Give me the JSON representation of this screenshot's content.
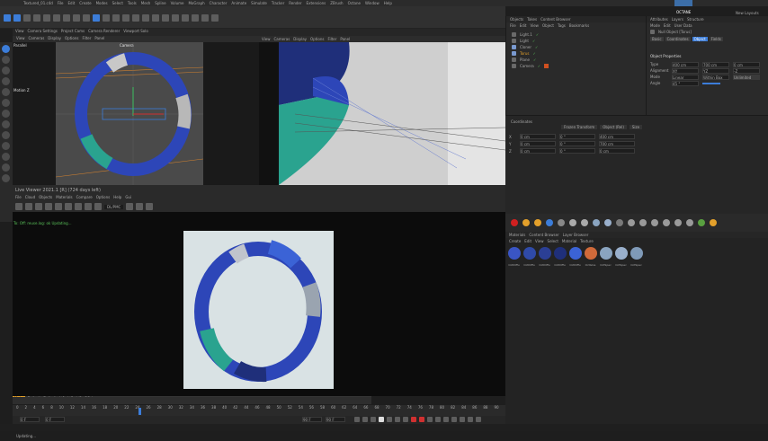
{
  "menubar": {
    "file_title": "Textured_01.c4d",
    "items": [
      "File",
      "Edit",
      "Create",
      "Modes",
      "Select",
      "Tools",
      "Mesh",
      "Spline",
      "Volume",
      "MoGraph",
      "Character",
      "Animate",
      "Simulate",
      "Tracker",
      "Render",
      "Extensions",
      "ZBrush",
      "Octane",
      "Window",
      "Help"
    ],
    "layout_tab": "OCTANE",
    "new_layouts": "New Layouts"
  },
  "viewport": {
    "tabs": [
      "View",
      "Camera Settings",
      "Project Cams",
      "Camera Renderer",
      "Viewport Solo"
    ],
    "menu": [
      "View",
      "Cameras",
      "Display",
      "Options",
      "Filter",
      "Panel"
    ],
    "perspective_label": "Parallel",
    "camera_label": "Camera",
    "axis_label": "Motion Z",
    "grid_spacing_label": "Grid Spacing",
    "grid_spacing_value": "500 cm",
    "right_menu": [
      "View",
      "Cameras",
      "Display",
      "Options",
      "Filter",
      "Panel"
    ]
  },
  "objects": {
    "tabs": [
      "Objects",
      "Takes",
      "Content Browser"
    ],
    "menu": [
      "File",
      "Edit",
      "View",
      "Object",
      "Tags",
      "Bookmarks"
    ],
    "items": [
      {
        "name": "Light.1",
        "color": "#c7c7c7"
      },
      {
        "name": "Light",
        "color": "#c7c7c7"
      },
      {
        "name": "Cloner",
        "color": "#e0b030"
      },
      {
        "name": "Torus",
        "color": "#e0b030"
      },
      {
        "name": "Plane",
        "color": "#c7c7c7"
      },
      {
        "name": "Camera",
        "color": "#c7c7c7"
      }
    ]
  },
  "attributes": {
    "tabs": [
      "Attributes",
      "Layers",
      "Structure"
    ],
    "menu": [
      "Mode",
      "Edit",
      "User Data"
    ],
    "title": "Null Object [Torus]",
    "subtabs": [
      "Basic",
      "Coordinates",
      "Object",
      "Fields"
    ],
    "active_subtab": "Object",
    "section": "Object Properties",
    "props": [
      {
        "label": "Type",
        "value": "400 cm",
        "value2": "700 cm",
        "value3": "0 cm"
      },
      {
        "label": "Alignment",
        "value": "XY",
        "value2": "YZ",
        "value3": "-Z"
      },
      {
        "label": "Mode",
        "value": "Linear",
        "value2": "Within Box",
        "value3": "Unlimited"
      },
      {
        "label": "Angle",
        "value": "45 °"
      }
    ]
  },
  "coordinates": {
    "title": "Coordinates",
    "buttons": [
      "Frozen Transform",
      "Object (Rel)",
      "Size"
    ],
    "rows": [
      {
        "axis": "X",
        "pos": "0 cm",
        "rot": "0 °",
        "size": "400 cm"
      },
      {
        "axis": "Y",
        "pos": "0 cm",
        "rot": "0 °",
        "size": "700 cm"
      },
      {
        "axis": "Z",
        "pos": "0 cm",
        "rot": "0 °",
        "size": "0 cm"
      }
    ]
  },
  "liveviewer": {
    "title": "Live Viewer 2021.1 [R] (724 days left)",
    "menu": [
      "File",
      "Cloud",
      "Objects",
      "Materials",
      "Compare",
      "Options",
      "Help",
      "Gui"
    ],
    "render_mode": "DL/PMC",
    "console_line": "To: Off: reuse.log: ok  Updating..."
  },
  "statusbar": {
    "tabs": [
      "Main",
      "Default",
      "Default",
      "Lt1",
      "Lt2",
      "Lt3",
      "GCol"
    ],
    "text": "Rendering: 100%  Ms/sec: 2.443  Time: 00 : 00 : 30/00 : 14 : 59  Spp/maxspp: 1/1024  Tri: 72k/799k  Mesh: 33  Hair: 0  RTXon  GPU: 54"
  },
  "timeline": {
    "ticks": [
      "0",
      "2",
      "4",
      "6",
      "8",
      "10",
      "12",
      "14",
      "16",
      "18",
      "20",
      "22",
      "24",
      "26",
      "28",
      "30",
      "32",
      "34",
      "36",
      "38",
      "40",
      "42",
      "44",
      "46",
      "48",
      "50",
      "52",
      "54",
      "56",
      "58",
      "60",
      "62",
      "64",
      "66",
      "68",
      "70",
      "72",
      "74",
      "76",
      "78",
      "80",
      "82",
      "84",
      "86",
      "88",
      "90"
    ],
    "current_frame": "0 F",
    "start_frame": "0 F",
    "end_frame": "90 F",
    "end_frame_2": "90 F"
  },
  "materials": {
    "tabs": [
      "Materials",
      "Content Browser",
      "Layer Browser"
    ],
    "menu": [
      "Create",
      "Edit",
      "View",
      "Select",
      "Material",
      "Texture"
    ],
    "items": [
      {
        "label": "OctDiffu",
        "color": "#3a55c4"
      },
      {
        "label": "OctDiffu",
        "color": "#2f4aa8"
      },
      {
        "label": "OctDiffu",
        "color": "#2b3f95"
      },
      {
        "label": "OctDiffu",
        "color": "#1f2f7a"
      },
      {
        "label": "OctDiffu",
        "color": "#3b63d6"
      },
      {
        "label": "OctGlos",
        "color": "#d06a3a"
      },
      {
        "label": "OctSpec",
        "color": "#8aa4c0"
      },
      {
        "label": "OctSpec",
        "color": "#9ab0cc"
      },
      {
        "label": "OctSpec",
        "color": "#7f9ab8"
      }
    ]
  },
  "bottom": {
    "status": "Updating..."
  },
  "colors": {
    "accent": "#3c7dd9",
    "orange": "#e3a02b",
    "ring_blue": "#2d46b8",
    "ring_teal": "#2aa38f"
  }
}
